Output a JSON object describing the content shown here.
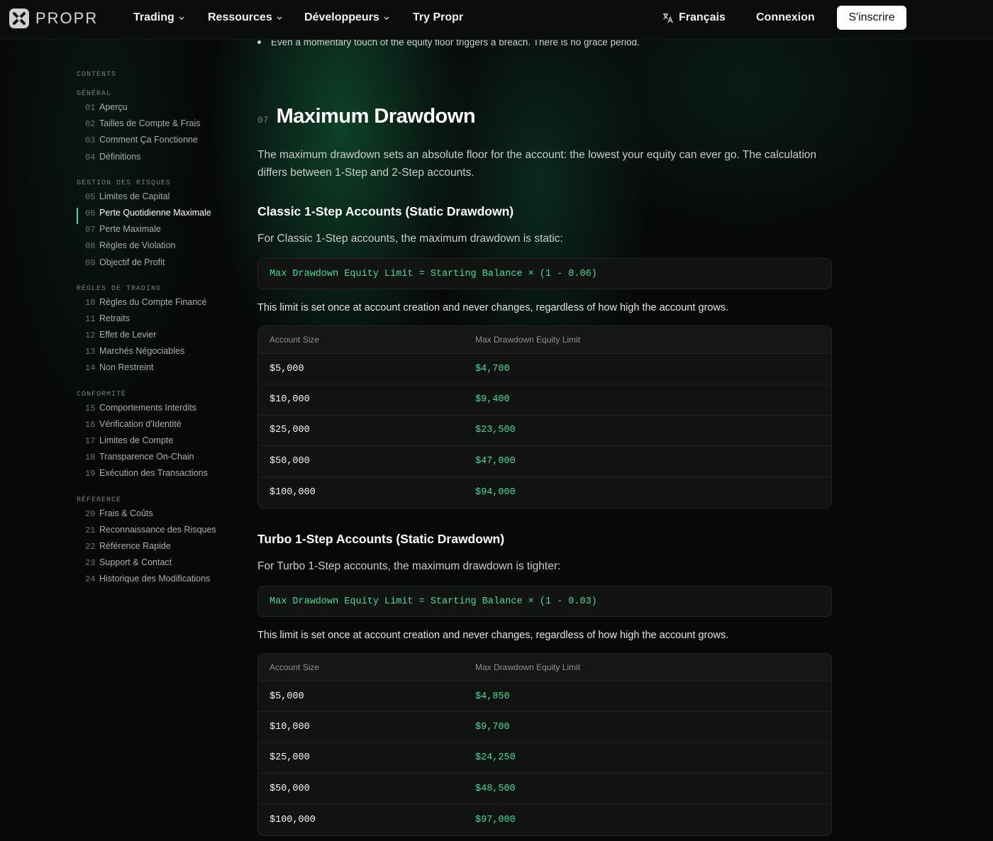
{
  "nav": {
    "logo_text": "PROPR",
    "items": [
      {
        "label": "Trading",
        "dropdown": true
      },
      {
        "label": "Ressources",
        "dropdown": true
      },
      {
        "label": "Développeurs",
        "dropdown": true
      },
      {
        "label": "Try Propr",
        "dropdown": false
      }
    ],
    "language": "Français",
    "login": "Connexion",
    "signup": "S'inscrire"
  },
  "sidebar": {
    "title": "CONTENTS",
    "sections": [
      {
        "label": "GÉNÉRAL",
        "items": [
          {
            "num": "01",
            "label": "Aperçu"
          },
          {
            "num": "02",
            "label": "Tailles de Compte & Frais"
          },
          {
            "num": "03",
            "label": "Comment Ça Fonctionne"
          },
          {
            "num": "04",
            "label": "Définitions"
          }
        ]
      },
      {
        "label": "GESTION DES RISQUES",
        "items": [
          {
            "num": "05",
            "label": "Limites de Capital"
          },
          {
            "num": "06",
            "label": "Perte Quotidienne Maximale",
            "active": true
          },
          {
            "num": "07",
            "label": "Perte Maximale"
          },
          {
            "num": "08",
            "label": "Règles de Violation"
          },
          {
            "num": "09",
            "label": "Objectif de Profit"
          }
        ]
      },
      {
        "label": "RÈGLES DE TRADING",
        "items": [
          {
            "num": "10",
            "label": "Règles du Compte Financé"
          },
          {
            "num": "11",
            "label": "Retraits"
          },
          {
            "num": "12",
            "label": "Effet de Levier"
          },
          {
            "num": "13",
            "label": "Marchés Négociables"
          },
          {
            "num": "14",
            "label": "Non Restreint"
          }
        ]
      },
      {
        "label": "CONFORMITÉ",
        "items": [
          {
            "num": "15",
            "label": "Comportements Interdits"
          },
          {
            "num": "16",
            "label": "Vérification d'Identité"
          },
          {
            "num": "17",
            "label": "Limites de Compte"
          },
          {
            "num": "18",
            "label": "Transparence On-Chain"
          },
          {
            "num": "19",
            "label": "Exécution des Transactions"
          }
        ]
      },
      {
        "label": "RÉFÉRENCE",
        "items": [
          {
            "num": "20",
            "label": "Frais & Coûts"
          },
          {
            "num": "21",
            "label": "Reconnaissance des Risques"
          },
          {
            "num": "22",
            "label": "Référence Rapide"
          },
          {
            "num": "23",
            "label": "Support & Contact"
          },
          {
            "num": "24",
            "label": "Historique des Modifications"
          }
        ]
      }
    ]
  },
  "main": {
    "bullet": "Even a momentary touch of the equity floor triggers a breach. There is no grace period.",
    "section_num": "07",
    "section_title": "Maximum Drawdown",
    "intro": "The maximum drawdown sets an absolute floor for the account: the lowest your equity can ever go. The calculation differs between 1-Step and 2-Step accounts.",
    "classic": {
      "title": "Classic 1-Step Accounts (Static Drawdown)",
      "desc": "For Classic 1-Step accounts, the maximum drawdown is static:",
      "formula": "Max Drawdown Equity Limit = Starting Balance × (1 - 0.06)",
      "note": "This limit is set once at account creation and never changes, regardless of how high the account grows.",
      "headers": [
        "Account Size",
        "Max Drawdown Equity Limit"
      ],
      "rows": [
        [
          "$5,000",
          "$4,700"
        ],
        [
          "$10,000",
          "$9,400"
        ],
        [
          "$25,000",
          "$23,500"
        ],
        [
          "$50,000",
          "$47,000"
        ],
        [
          "$100,000",
          "$94,000"
        ]
      ]
    },
    "turbo": {
      "title": "Turbo 1-Step Accounts (Static Drawdown)",
      "desc": "For Turbo 1-Step accounts, the maximum drawdown is tighter:",
      "formula": "Max Drawdown Equity Limit = Starting Balance × (1 - 0.03)",
      "note": "This limit is set once at account creation and never changes, regardless of how high the account grows.",
      "headers": [
        "Account Size",
        "Max Drawdown Equity Limit"
      ],
      "rows": [
        [
          "$5,000",
          "$4,850"
        ],
        [
          "$10,000",
          "$9,700"
        ],
        [
          "$25,000",
          "$24,250"
        ],
        [
          "$50,000",
          "$48,500"
        ],
        [
          "$100,000",
          "$97,000"
        ]
      ]
    }
  },
  "colors": {
    "accent": "#3ddc97",
    "background": "#070908"
  }
}
